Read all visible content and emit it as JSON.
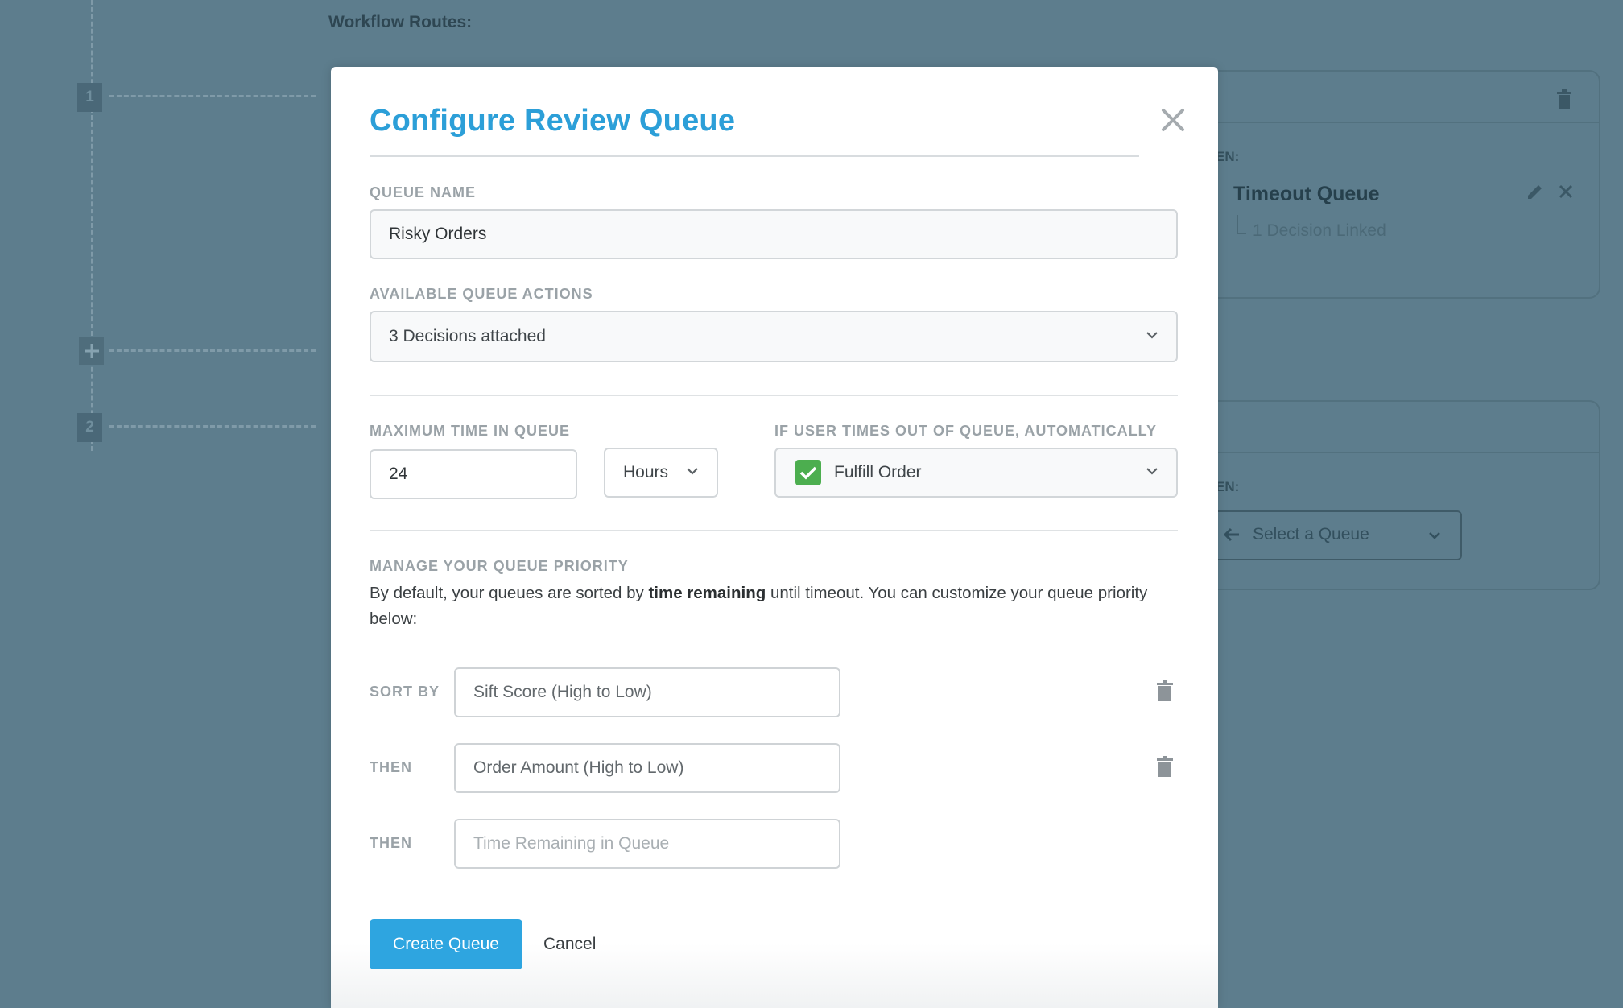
{
  "background": {
    "title": "Workflow Routes:",
    "steps": [
      "1",
      "2"
    ],
    "route1": {
      "then_label": "EN:",
      "queue_name": "Timeout Queue",
      "linked": "1 Decision Linked"
    },
    "route2": {
      "then_label": "EN:",
      "select_placeholder": "Select a Queue"
    }
  },
  "modal": {
    "title": "Configure Review Queue",
    "queue_name": {
      "label": "QUEUE NAME",
      "value": "Risky Orders"
    },
    "actions": {
      "label": "AVAILABLE QUEUE ACTIONS",
      "value": "3 Decisions attached"
    },
    "max_time": {
      "label": "MAXIMUM TIME IN QUEUE",
      "value": "24",
      "unit": "Hours"
    },
    "timeout": {
      "label": "IF USER TIMES OUT OF QUEUE, AUTOMATICALLY",
      "value": "Fulfill Order",
      "checked": true
    },
    "priority": {
      "label": "MANAGE YOUR QUEUE PRIORITY",
      "desc_before": "By default, your queues are sorted by ",
      "desc_bold": "time remaining",
      "desc_after": " until timeout. You can customize your queue priority below:",
      "rows": [
        {
          "label": "SORT BY",
          "value": "Sift Score (High to Low)"
        },
        {
          "label": "THEN",
          "value": "Order Amount (High to Low)"
        },
        {
          "label": "THEN",
          "placeholder": "Time Remaining in Queue"
        }
      ]
    },
    "buttons": {
      "create": "Create Queue",
      "cancel": "Cancel"
    }
  },
  "colors": {
    "accent": "#2ea5e0",
    "title": "#2c9fd8",
    "check": "#4cae4f",
    "overlay": "#5d7d8d"
  }
}
